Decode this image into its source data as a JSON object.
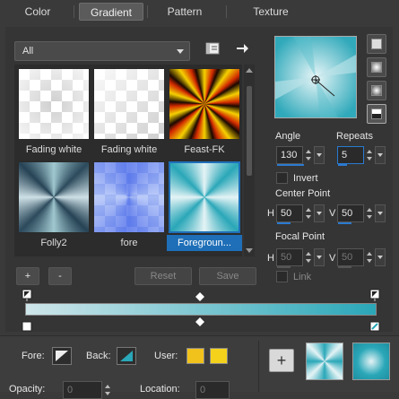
{
  "tabs": [
    "Color",
    "Gradient",
    "Pattern",
    "Texture"
  ],
  "library": {
    "category": "All",
    "items": [
      {
        "label": "Fading white"
      },
      {
        "label": "Fading white"
      },
      {
        "label": "Feast-FK"
      },
      {
        "label": "Folly2"
      },
      {
        "label": "fore"
      },
      {
        "label": "Foregroun..."
      }
    ]
  },
  "list_buttons": {
    "add": "+",
    "remove": "-",
    "reset": "Reset",
    "save": "Save"
  },
  "angle": {
    "label": "Angle",
    "value": "130"
  },
  "repeats": {
    "label": "Repeats",
    "value": "5"
  },
  "invert": {
    "label": "Invert"
  },
  "center_point": {
    "label": "Center Point",
    "h_label": "H",
    "h": "50",
    "v_label": "V",
    "v": "50"
  },
  "focal_point": {
    "label": "Focal Point",
    "h_label": "H",
    "h": "50",
    "v_label": "V",
    "v": "50"
  },
  "link": {
    "label": "Link"
  },
  "bottom": {
    "fore_label": "Fore:",
    "back_label": "Back:",
    "user_label": "User:",
    "opacity_label": "Opacity:",
    "opacity": "0",
    "location_label": "Location:",
    "location": "0",
    "add_button": "+"
  },
  "colors": {
    "accent": "#2a7ad0",
    "user1": "#f2c21c",
    "user2": "#f4d21c",
    "gradient_start": "#cfe6ea",
    "gradient_end": "#2aa7b8"
  }
}
